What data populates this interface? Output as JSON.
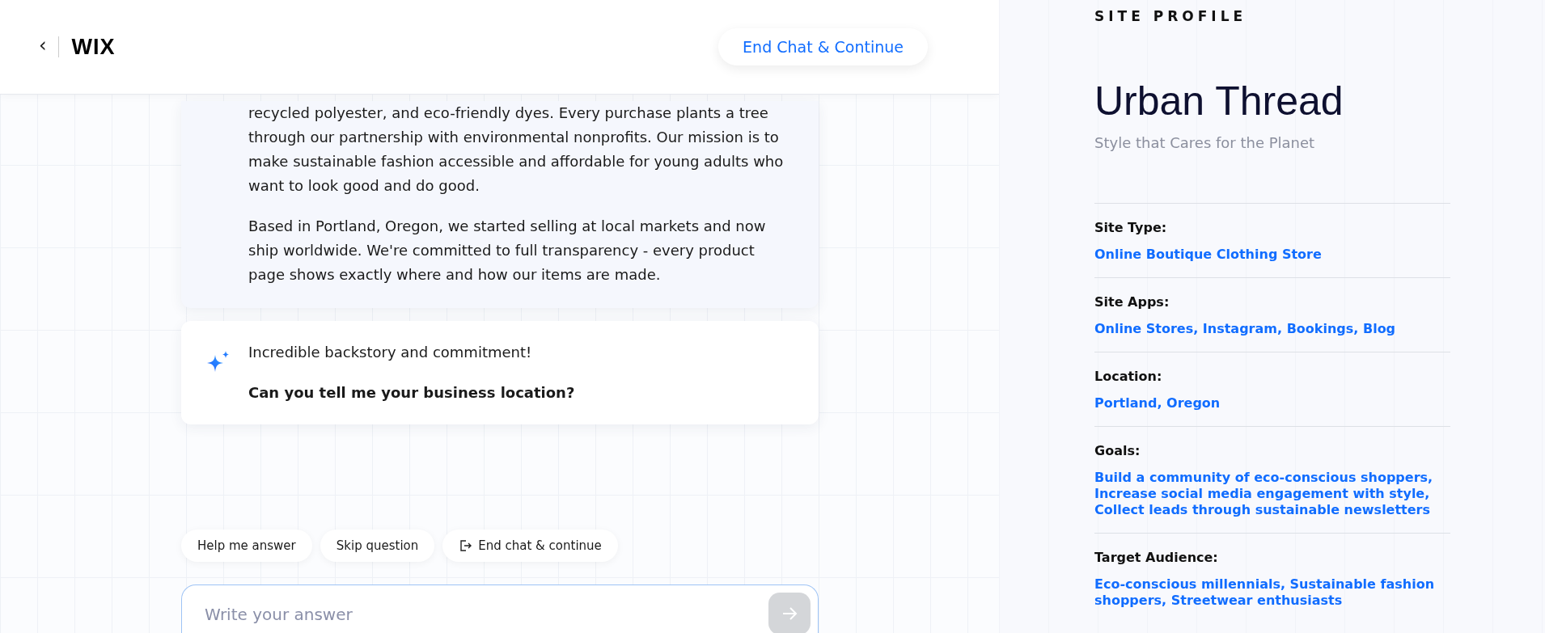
{
  "header": {
    "back_label": "‹",
    "logo": "WIX",
    "end_button": "End Chat & Continue"
  },
  "chat": {
    "messages": [
      {
        "kind": "user",
        "paragraphs": [
          "recycled polyester, and eco-friendly dyes. Every purchase plants a tree through our partnership with environmental nonprofits. Our mission is to make sustainable fashion accessible and affordable for young adults who want to look good and do good.",
          "Based in Portland, Oregon, we started selling at local markets and now ship worldwide. We're committed to full transparency - every product page shows exactly where and how our items are made."
        ]
      },
      {
        "kind": "assistant",
        "paragraphs": [
          "Incredible backstory and commitment!",
          "**Can you tell me your business location?**"
        ]
      }
    ],
    "chips": [
      {
        "label": "Help me answer",
        "kind": "plain"
      },
      {
        "label": "Skip question",
        "kind": "plain"
      },
      {
        "label": "End chat & continue",
        "kind": "exit"
      }
    ],
    "input": {
      "placeholder": "Write your answer"
    }
  },
  "profile": {
    "heading": "SITE PROFILE",
    "name": "Urban Thread",
    "tagline": "Style that Cares for the Planet",
    "fields": [
      {
        "label": "Site Type:",
        "value": "Online Boutique Clothing Store"
      },
      {
        "label": "Site Apps:",
        "value": "Online Stores, Instagram, Bookings, Blog"
      },
      {
        "label": "Location:",
        "value": "Portland, Oregon"
      },
      {
        "label": "Goals:",
        "value": "Build a community of eco-conscious shoppers,\nIncrease social media engagement with style,\nCollect leads through sustainable newsletters"
      },
      {
        "label": "Target Audience:",
        "value": "Eco-conscious millennials, Sustainable fashion\nshoppers, Streetwear enthusiasts"
      }
    ]
  }
}
